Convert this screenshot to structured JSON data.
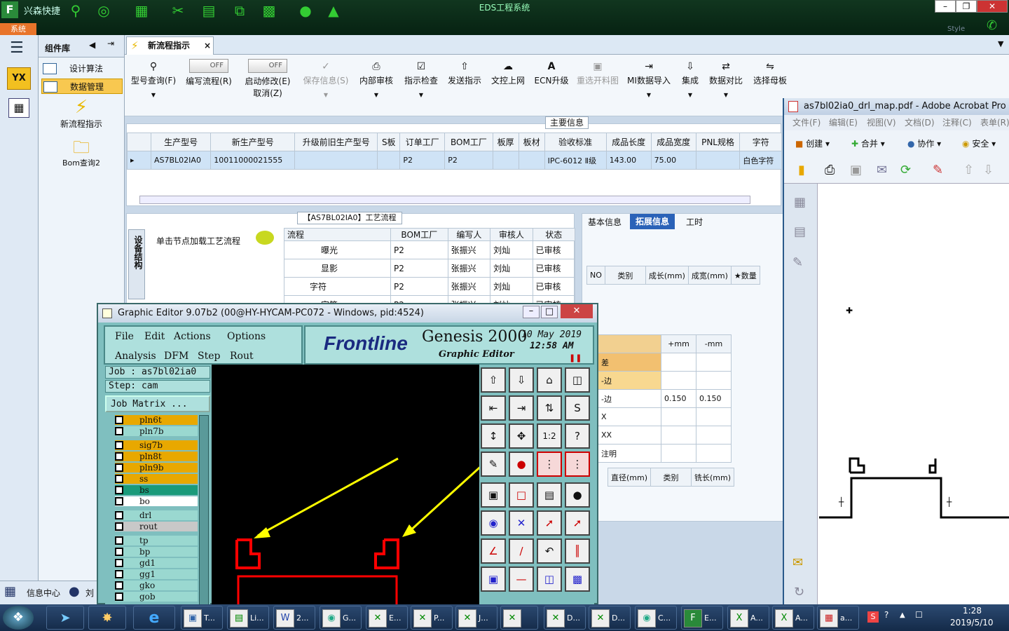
{
  "topbar": {
    "app_name": "兴森快捷",
    "system_title": "EDS工程系统",
    "system_tab": "系统",
    "style_label": "Style"
  },
  "sidebar": {
    "header": "组件库",
    "items": [
      {
        "label": "设计算法"
      },
      {
        "label": "数据管理"
      }
    ],
    "actions": [
      {
        "label": "新流程指示"
      },
      {
        "label": "Bom查询2"
      }
    ],
    "yx_logo": "YX"
  },
  "doc_tab": {
    "label": "新流程指示"
  },
  "ribbon": {
    "buttons": [
      {
        "label": "型号查询(F)"
      },
      {
        "label": "编写流程(R)",
        "toggle": "OFF"
      },
      {
        "label": "启动修改(E)",
        "sub": "取消(Z)",
        "toggle": "OFF"
      },
      {
        "label": "保存信息(S)"
      },
      {
        "label": "内部审核"
      },
      {
        "label": "指示检查"
      },
      {
        "label": "发送指示"
      },
      {
        "label": "文控上网"
      },
      {
        "label": "ECN升级"
      },
      {
        "label": "重选开料图"
      },
      {
        "label": "MI数据导入"
      },
      {
        "label": "集成"
      },
      {
        "label": "数据对比"
      },
      {
        "label": "选择母板"
      }
    ]
  },
  "main_info": {
    "title": "主要信息",
    "columns": [
      "生产型号",
      "新生产型号",
      "升级前旧生产型号",
      "S板",
      "订单工厂",
      "BOM工厂",
      "板厚",
      "板材",
      "验收标准",
      "成品长度",
      "成品宽度",
      "PNL规格",
      "字符"
    ],
    "row": [
      "AS7BL02IA0",
      "10011000021555",
      "",
      "",
      "P2",
      "P2",
      "",
      "",
      "IPC-6012 Ⅱ级",
      "143.00",
      "75.00",
      "",
      "白色字符"
    ]
  },
  "flow": {
    "title": "【AS7BL02IA0】工艺流程",
    "side_tab": "设备结构",
    "hint": "单击节点加载工艺流程",
    "columns": [
      "流程",
      "BOM工厂",
      "编写人",
      "审核人",
      "状态"
    ],
    "rows": [
      {
        "name": "曝光",
        "bom": "P2",
        "writer": "张振兴",
        "reviewer": "刘灿",
        "status": "已审核"
      },
      {
        "name": "显影",
        "bom": "P2",
        "writer": "张振兴",
        "reviewer": "刘灿",
        "status": "已审核"
      },
      {
        "name": "字符",
        "bom": "P2",
        "writer": "张振兴",
        "reviewer": "刘灿",
        "status": "已审核"
      },
      {
        "name": "字符",
        "bom": "P2",
        "writer": "张振兴",
        "reviewer": "刘灿",
        "status": "已审核"
      }
    ]
  },
  "ext_info": {
    "tabs": [
      "基本信息",
      "拓展信息",
      "工时"
    ],
    "table1_cols": [
      "NO",
      "类别",
      "成长(mm)",
      "成宽(mm)",
      "★数量"
    ],
    "tol_cols": [
      "+mm",
      "-mm"
    ],
    "tol_rows": [
      {
        "label": "差",
        "plus": "",
        "minus": ""
      },
      {
        "label": "-边",
        "plus": "",
        "minus": ""
      },
      {
        "label": "-边",
        "plus": "0.150",
        "minus": "0.150"
      },
      {
        "label": "X",
        "plus": "",
        "minus": ""
      },
      {
        "label": "XX",
        "plus": "",
        "minus": ""
      },
      {
        "label": "注明",
        "plus": "",
        "minus": ""
      }
    ],
    "table3_cols": [
      "直径(mm)",
      "类别",
      "铣长(mm)"
    ]
  },
  "graphic_editor": {
    "title": "Graphic Editor 9.07b2 (00@HY-HYCAM-PC072 - Windows, pid:4524)",
    "menu": [
      "File",
      "Edit",
      "Actions",
      "Options",
      "Analysis",
      "DFM",
      "Step",
      "Rout"
    ],
    "brand": "Frontline",
    "product": "Genesis 2000",
    "subtitle": "Graphic Editor",
    "date": "10 May 2019",
    "time": "12:58 AM",
    "job": "Job : as7bl02ia0",
    "step": "Step: cam",
    "matrix_btn": "Job Matrix ...",
    "layers": [
      {
        "name": "pln6t",
        "color": "#e8a800"
      },
      {
        "name": "pln7b",
        "color": "#9ad8d0"
      },
      {
        "name": "sig7b",
        "color": "#e8a800"
      },
      {
        "name": "pln8t",
        "color": "#e8a800"
      },
      {
        "name": "pln9b",
        "color": "#e8a800"
      },
      {
        "name": "ss",
        "color": "#e8a800"
      },
      {
        "name": "bs",
        "color": "#1a9a7a"
      },
      {
        "name": "bo",
        "color": "#ffffff"
      },
      {
        "name": "drl",
        "color": "#9ad8d0"
      },
      {
        "name": "rout",
        "color": "#c8c8c8"
      },
      {
        "name": "tp",
        "color": "#9ad8d0"
      },
      {
        "name": "bp",
        "color": "#9ad8d0"
      },
      {
        "name": "gd1",
        "color": "#9ad8d0"
      },
      {
        "name": "gg1",
        "color": "#9ad8d0"
      },
      {
        "name": "gko",
        "color": "#9ad8d0"
      },
      {
        "name": "gob",
        "color": "#9ad8d0"
      }
    ]
  },
  "acrobat": {
    "title": "as7bl02ia0_drl_map.pdf - Adobe Acrobat Pro",
    "menu": [
      "文件(F)",
      "编辑(E)",
      "视图(V)",
      "文档(D)",
      "注释(C)",
      "表单(R)"
    ],
    "tools": [
      "创建",
      "合并",
      "协作",
      "安全"
    ]
  },
  "statusbar": {
    "info_center": "信息中心",
    "user": "刘"
  },
  "taskbar": {
    "apps": [
      "T...",
      "Li...",
      "2...",
      "G...",
      "E...",
      "P...",
      "J...",
      "",
      "D...",
      "D...",
      "C...",
      "E...",
      "A...",
      "A...",
      "a..."
    ],
    "time": "1:28",
    "date": "2019/5/10"
  }
}
